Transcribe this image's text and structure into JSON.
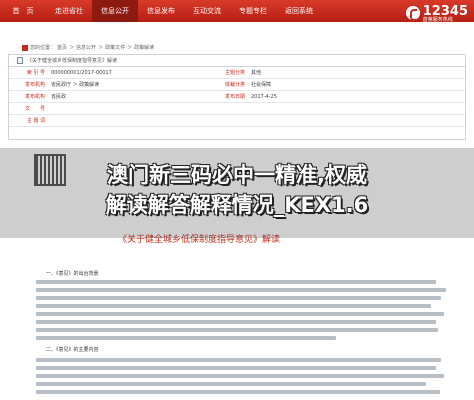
{
  "nav": {
    "items": [
      "首　页",
      "走进省社",
      "信息公开",
      "信息发布",
      "互动交流",
      "专题专栏",
      "返回系统"
    ],
    "active_index": 2
  },
  "hotline": {
    "small": "12345 政务服务热线",
    "number": "12345",
    "sub": "首席服务热线"
  },
  "breadcrumb": [
    "您的位置：",
    "首页",
    "＞",
    "信息公开",
    "＞",
    "政策文件",
    "＞",
    "政策解读"
  ],
  "infobox": {
    "header": "《关于健全城乡低保制度指导意见》解读",
    "rows": [
      {
        "l1": "索 引 号",
        "v1": "000000001/2017-00017",
        "l2": "主题分类",
        "v2": "其他"
      },
      {
        "l1": "发布机构",
        "v1": "省民政厅 ＞ 政策解读",
        "l2": "体裁分类",
        "v2": "社会保障"
      },
      {
        "l1": "发布机构",
        "v1": "省民政",
        "l2": "发布日期",
        "v2": "2017-4-25"
      },
      {
        "l1": "文　　号",
        "v1": "",
        "l2": "",
        "v2": ""
      },
      {
        "l1": "主 题 词",
        "v1": "",
        "l2": "",
        "v2": ""
      }
    ]
  },
  "document": {
    "title": "《关于健全城乡低保制度指导意见》解读",
    "section1": "一、《意见》的出台背景",
    "section2": "二、《意见》的主要内容"
  },
  "headline": {
    "line1": "澳门新三码必中一精准,权威",
    "line2": "解读解答解释情况_KEX1.6"
  },
  "colors": {
    "brand_red": "#c52a1c",
    "nav_active": "#8c1a10"
  }
}
